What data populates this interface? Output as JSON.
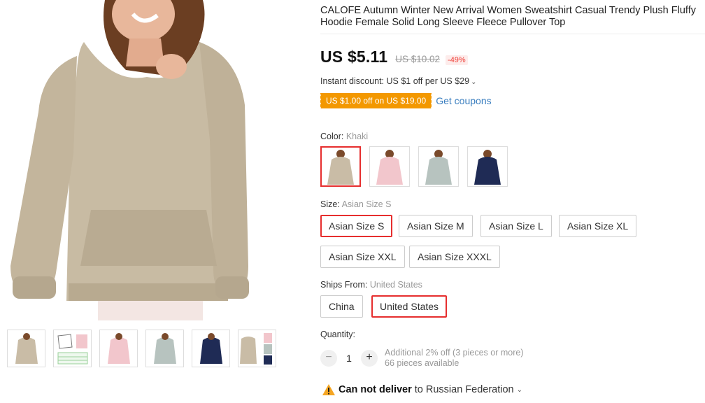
{
  "product": {
    "title": "CALOFE Autumn Winter New Arrival Women Sweatshirt Casual Trendy Plush Fluffy Hoodie Female Solid Long Sleeve Fleece Pullover Top",
    "price": "US $5.11",
    "original_price": "US $10.02",
    "discount": "-49%"
  },
  "promo": {
    "instant_discount": "Instant discount: US $1 off per US $29",
    "coupon_label": "US $1.00 off on US $19.00",
    "get_coupons": "Get coupons"
  },
  "color": {
    "label": "Color: ",
    "selected": "Khaki",
    "swatches": [
      {
        "name": "Khaki",
        "hex": "#c9bca6"
      },
      {
        "name": "Pink",
        "hex": "#f2c6cc"
      },
      {
        "name": "Grey",
        "hex": "#b7c3bf"
      },
      {
        "name": "Navy",
        "hex": "#1f2b55"
      }
    ]
  },
  "size": {
    "label": "Size: ",
    "selected": "Asian Size S",
    "options": [
      "Asian Size S",
      "Asian Size M",
      "Asian Size L",
      "Asian Size XL",
      "Asian Size XXL",
      "Asian Size XXXL"
    ]
  },
  "ships_from": {
    "label": "Ships From: ",
    "selected": "United States",
    "options": [
      "China",
      "United States"
    ]
  },
  "quantity": {
    "label": "Quantity:",
    "minus": "−",
    "value": "1",
    "plus": "+",
    "note": "Additional 2% off (3 pieces or more)",
    "available": "66 pieces available"
  },
  "delivery": {
    "status": "Can not deliver",
    "destination": "to Russian Federation",
    "chevron": "⌄"
  },
  "chevron": "⌄",
  "colors": {
    "accent_red": "#e62e2e",
    "coupon_orange": "#f39800",
    "link_blue": "#3a7ebf",
    "khaki": "#c9bca6"
  }
}
